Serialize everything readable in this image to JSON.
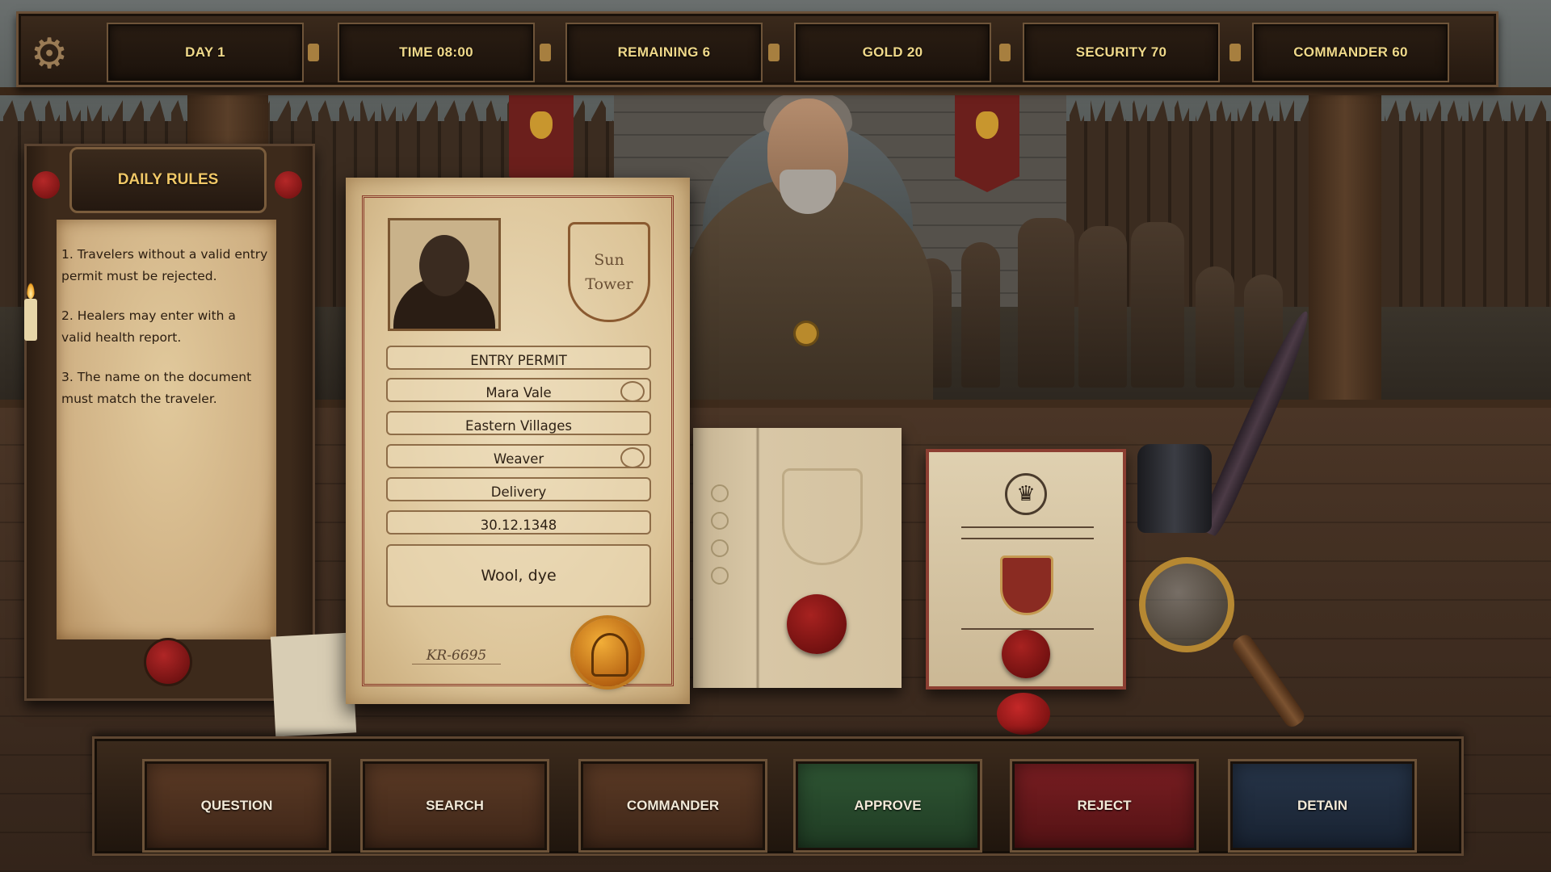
{
  "hud": {
    "settings_icon": "gear-icon",
    "day": "DAY 1",
    "time": "TIME 08:00",
    "remaining": "REMAINING 6",
    "gold": "GOLD 20",
    "security": "SECURITY 70",
    "commander": "COMMANDER 60"
  },
  "rules": {
    "title": "DAILY RULES",
    "items": [
      "1. Travelers without a valid entry permit must be rejected.",
      "2. Healers may enter with a valid health report.",
      "3. The name on the document must match the traveler."
    ]
  },
  "permit": {
    "crest_line1": "Sun",
    "crest_line2": "Tower",
    "title": "ENTRY PERMIT",
    "name": "Mara Vale",
    "origin": "Eastern Villages",
    "occupation": "Weaver",
    "purpose": "Delivery",
    "date": "30.12.1348",
    "goods": "Wool, dye",
    "id": "KR-6695"
  },
  "actions": {
    "question": "QUESTION",
    "search": "SEARCH",
    "commander": "COMMANDER",
    "approve": "APPROVE",
    "reject": "REJECT",
    "detain": "DETAIN"
  },
  "colors": {
    "hud_text": "#f0d98a",
    "approve": "#2f5634",
    "reject": "#7a1e22",
    "detain": "#273549",
    "seal_red": "#a72220",
    "seal_gold": "#d98b22"
  }
}
